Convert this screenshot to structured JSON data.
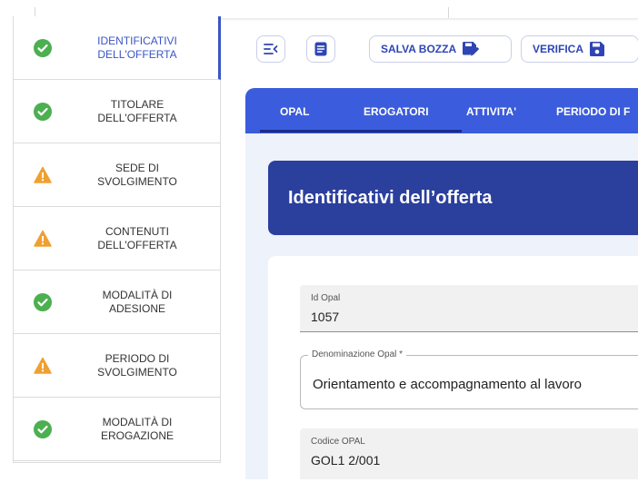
{
  "sidebar": {
    "items": [
      {
        "label": "IDENTIFICATIVI DELL'OFFERTA",
        "status": "complete",
        "active": true
      },
      {
        "label": "TITOLARE DELL'OFFERTA",
        "status": "complete"
      },
      {
        "label": "SEDE DI SVOLGIMENTO",
        "status": "warning"
      },
      {
        "label": "CONTENUTI DELL'OFFERTA",
        "status": "warning"
      },
      {
        "label": "MODALITÀ DI ADESIONE",
        "status": "complete"
      },
      {
        "label": "PERIODO DI SVOLGIMENTO",
        "status": "warning"
      },
      {
        "label": "MODALITÀ DI EROGAZIONE",
        "status": "complete"
      }
    ],
    "colors": {
      "complete": "#4caf50",
      "warning": "#f0a030",
      "active": "#3a55c6"
    }
  },
  "toolbar": {
    "collapse_icon": "collapse-menu-icon",
    "doc_icon": "document-icon",
    "save_draft_label": "SALVA BOZZA",
    "verify_label": "VERIFICA"
  },
  "tabs": [
    {
      "label": "OPAL",
      "active": true
    },
    {
      "label": "EROGATORI"
    },
    {
      "label": "ATTIVITA'"
    },
    {
      "label": "PERIODO DI F"
    }
  ],
  "section": {
    "title": "Identificativi dell’offerta"
  },
  "form": {
    "id_opal": {
      "label": "Id Opal",
      "value": "1057"
    },
    "denominazione": {
      "label": "Denominazione Opal *",
      "value": "Orientamento e accompagnamento al lavoro"
    },
    "codice": {
      "label": "Codice OPAL",
      "value": "GOL1 2/001"
    }
  },
  "colors": {
    "primary": "#3b5cdc",
    "hero": "#2b3f9d",
    "content_bg": "#edf2fb"
  }
}
